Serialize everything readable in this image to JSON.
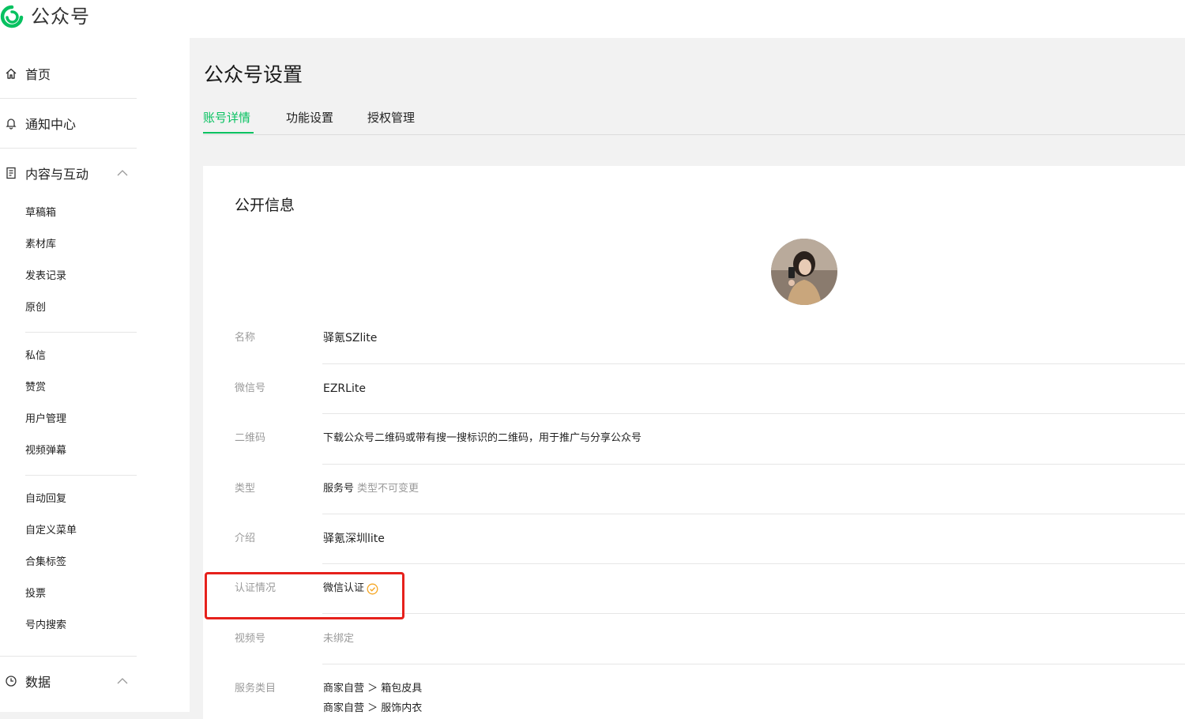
{
  "app": {
    "title": "公众号"
  },
  "sidebar": {
    "home": "首页",
    "notifications": "通知中心",
    "content": "内容与互动",
    "content_items": [
      "草稿箱",
      "素材库",
      "发表记录",
      "原创"
    ],
    "interaction_items": [
      "私信",
      "赞赏",
      "用户管理",
      "视频弹幕"
    ],
    "feature_items": [
      "自动回复",
      "自定义菜单",
      "合集标签",
      "投票",
      "号内搜索"
    ],
    "data": "数据"
  },
  "page": {
    "title": "公众号设置",
    "tabs": [
      "账号详情",
      "功能设置",
      "授权管理"
    ]
  },
  "info": {
    "section_title": "公开信息",
    "rows": [
      {
        "label": "名称",
        "value": "驿氪SZlite"
      },
      {
        "label": "微信号",
        "value": "EZRLite"
      },
      {
        "label": "二维码",
        "value": "下载公众号二维码或带有搜一搜标识的二维码，用于推广与分享公众号"
      },
      {
        "label": "类型",
        "value": "服务号",
        "note": "类型不可变更"
      },
      {
        "label": "介绍",
        "value": "驿氪深圳lite"
      },
      {
        "label": "认证情况",
        "value": "微信认证"
      },
      {
        "label": "视频号",
        "value": "未绑定"
      },
      {
        "label": "服务类目",
        "value": "商家自营 ＞ 箱包皮具",
        "value2": "商家自营 ＞ 服饰内衣"
      }
    ]
  },
  "colors": {
    "accent": "#07c160",
    "highlight": "#e6211c",
    "verified": "#f5a623"
  }
}
